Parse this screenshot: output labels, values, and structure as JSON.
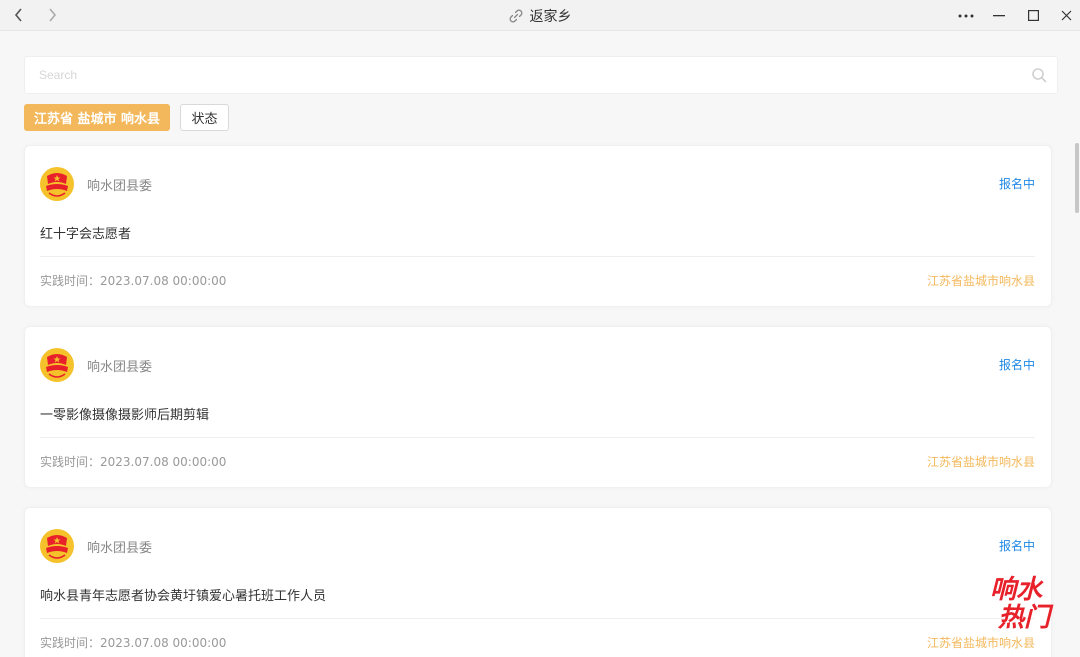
{
  "window": {
    "title": "返家乡"
  },
  "search": {
    "placeholder": "Search"
  },
  "filters": {
    "region": "江苏省 盐城市 响水县",
    "status": "状态"
  },
  "cards": [
    {
      "org": "响水团县委",
      "status": "报名中",
      "title": "红十字会志愿者",
      "time": "实践时间：2023.07.08 00:00:00",
      "location": "江苏省盐城市响水县"
    },
    {
      "org": "响水团县委",
      "status": "报名中",
      "title": "一零影像摄像摄影师后期剪辑",
      "time": "实践时间：2023.07.08 00:00:00",
      "location": "江苏省盐城市响水县"
    },
    {
      "org": "响水团县委",
      "status": "报名中",
      "title": "响水县青年志愿者协会黄圩镇爱心暑托班工作人员",
      "time": "实践时间：2023.07.08 00:00:00",
      "location": "江苏省盐城市响水县"
    }
  ],
  "colors": {
    "accent": "#f3b85b",
    "status_blue": "#1e88e5",
    "watermark_red": "#e8202a"
  },
  "watermark": {
    "text": "响水热门"
  }
}
